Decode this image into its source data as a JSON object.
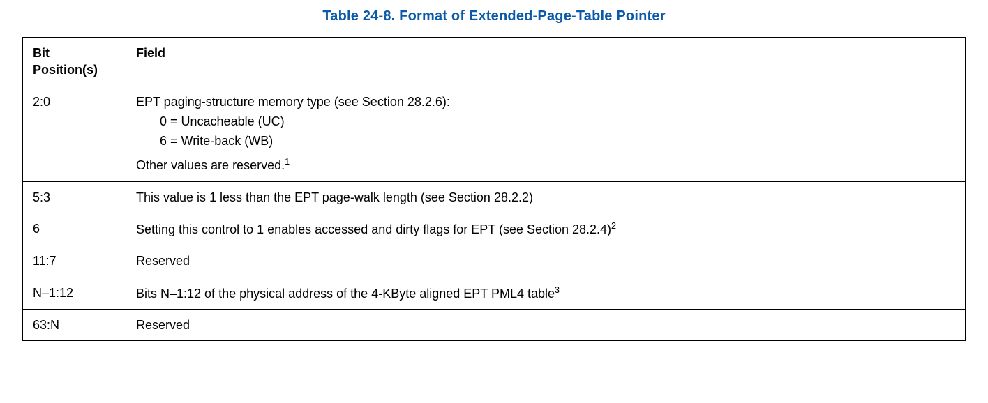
{
  "title": "Table 24-8.  Format of Extended-Page-Table Pointer",
  "headers": {
    "bit": "Bit Position(s)",
    "field": "Field"
  },
  "rows": [
    {
      "bit": "2:0",
      "field_main": "EPT paging-structure memory type (see Section 28.2.6):",
      "field_sub1": "0 = Uncacheable (UC)",
      "field_sub2": "6 = Write-back (WB)",
      "field_after": "Other values are reserved.",
      "field_after_sup": "1"
    },
    {
      "bit": "5:3",
      "field_main": "This value is 1 less than the EPT page-walk length (see Section 28.2.2)"
    },
    {
      "bit": "6",
      "field_main": "Setting this control to 1 enables accessed and dirty flags for EPT (see Section 28.2.4)",
      "field_main_sup": "2"
    },
    {
      "bit": "11:7",
      "field_main": "Reserved"
    },
    {
      "bit": "N–1:12",
      "field_main": "Bits N–1:12 of the physical address of the 4-KByte aligned EPT PML4 table",
      "field_main_sup": "3"
    },
    {
      "bit": "63:N",
      "field_main": "Reserved"
    }
  ]
}
